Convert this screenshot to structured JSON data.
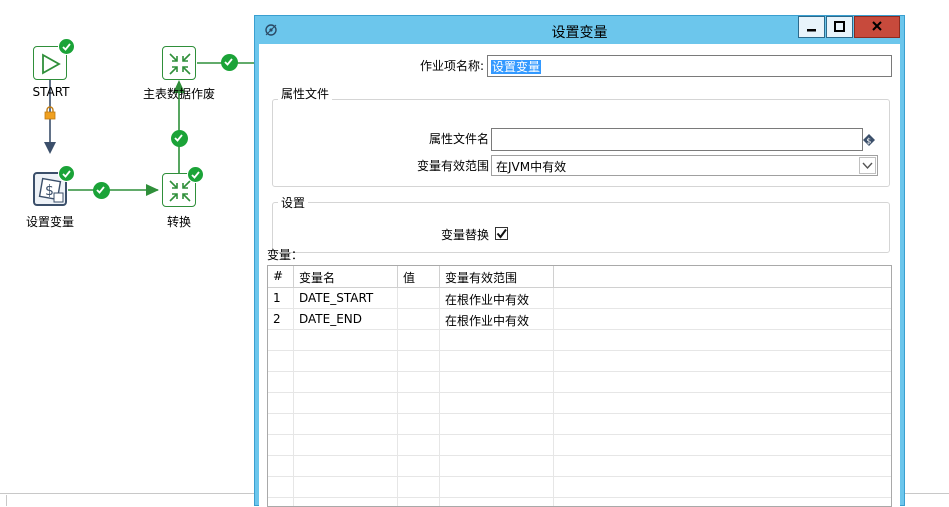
{
  "canvas": {
    "nodes": {
      "start": {
        "label": "START"
      },
      "set_vars": {
        "label": "设置变量"
      },
      "main_table": {
        "label": "主表数据作废"
      },
      "transform": {
        "label": "转换"
      }
    }
  },
  "dialog": {
    "title": "设置变量",
    "job_entry_name_label": "作业项名称:",
    "job_entry_name_value": "设置变量",
    "properties_group": {
      "title": "属性文件",
      "filename_label": "属性文件名",
      "filename_value": "",
      "scope_label": "变量有效范围",
      "scope_value": "在JVM中有效"
    },
    "settings_group": {
      "title": "设置",
      "replace_label": "变量替换",
      "replace_checked": true
    },
    "variables_label": "变量：",
    "table": {
      "columns": [
        "#",
        "变量名",
        "值",
        "变量有效范围"
      ],
      "rows": [
        {
          "num": "1",
          "name": "DATE_START",
          "value": "",
          "scope": "在根作业中有效"
        },
        {
          "num": "2",
          "name": "DATE_END",
          "value": "",
          "scope": "在根作业中有效"
        }
      ]
    }
  },
  "colors": {
    "dialog_frame": "#6cc6ec",
    "success_badge": "#1ba338",
    "hop_line": "#2f8f3a",
    "selection": "#3399ff"
  }
}
